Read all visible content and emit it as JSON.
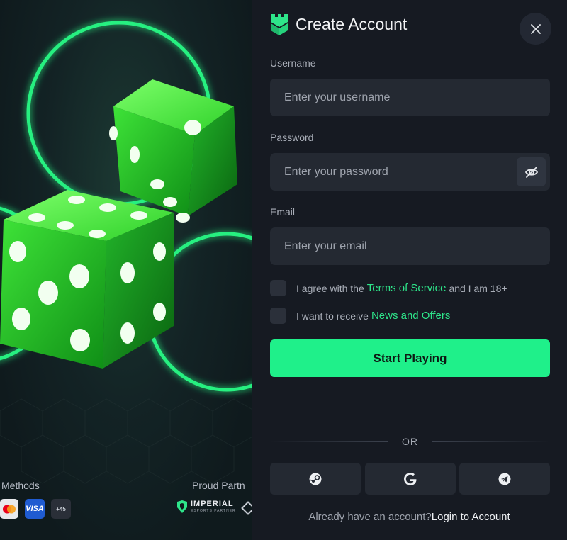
{
  "colors": {
    "accent": "#1ff08a",
    "link": "#2ee58a",
    "panel_bg": "#161a22",
    "field_bg": "#242932"
  },
  "header": {
    "title": "Create Account",
    "logo_icon": "castle-tower-icon",
    "close_icon": "close-icon"
  },
  "form": {
    "username": {
      "label": "Username",
      "placeholder": "Enter your username",
      "value": ""
    },
    "password": {
      "label": "Password",
      "placeholder": "Enter your password",
      "value": "",
      "toggle_icon": "eye-off-icon"
    },
    "email": {
      "label": "Email",
      "placeholder": "Enter your email",
      "value": ""
    },
    "terms": {
      "prefix": "I agree with the",
      "link": "Terms of Service",
      "suffix": "and I am 18+",
      "checked": false
    },
    "news": {
      "prefix": "I want to receive",
      "link": "News and Offers",
      "checked": false
    },
    "submit_label": "Start Playing"
  },
  "divider": "OR",
  "social": [
    {
      "icon": "steam-icon"
    },
    {
      "icon": "google-icon"
    },
    {
      "icon": "telegram-icon"
    }
  ],
  "footer": {
    "prompt": "Already have an account?",
    "login": "Login to Account"
  },
  "promo": {
    "payment_label": "Methods",
    "partner_label": "Proud Partn",
    "payment_chips": [
      "mastercard-icon",
      "VISA",
      "+45"
    ],
    "partner_name": "IMPERIAL",
    "partner_sub": "ESPORTS PARTNER"
  }
}
